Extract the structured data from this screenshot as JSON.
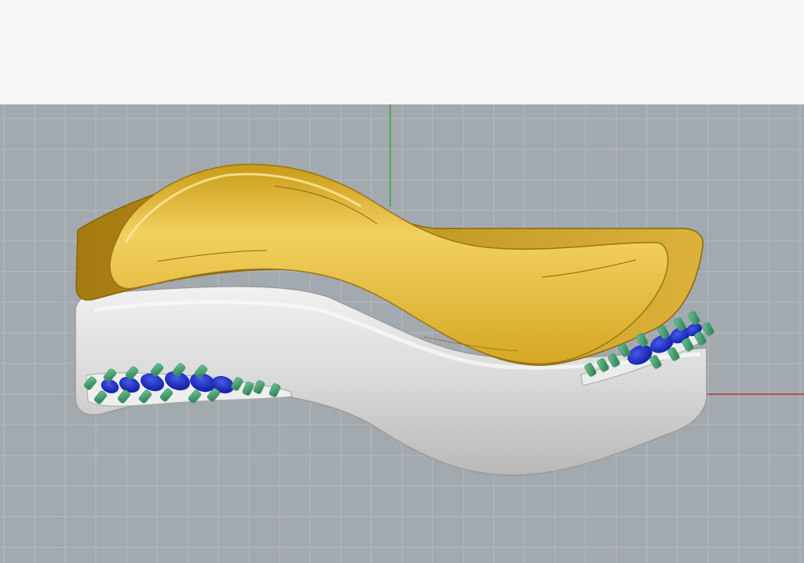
{
  "app": {
    "toolbar_background": "#f6f6f6"
  },
  "viewport": {
    "projection": "front",
    "background": "#a2a9af",
    "grid_on": true,
    "grid_color": "#b5bbc0",
    "axis_y_color": "#2fa83a",
    "axis_x_color": "#c0392b"
  },
  "model": {
    "upper_band_color": "#e9c247",
    "lower_band_color": "#d9d9d9",
    "stone_color": "#1c2ec8",
    "prong_color": "#3e9a6a",
    "icons": [
      "gold-wave-band",
      "silver-wave-band",
      "gem-setting-left",
      "gem-setting-right"
    ]
  }
}
